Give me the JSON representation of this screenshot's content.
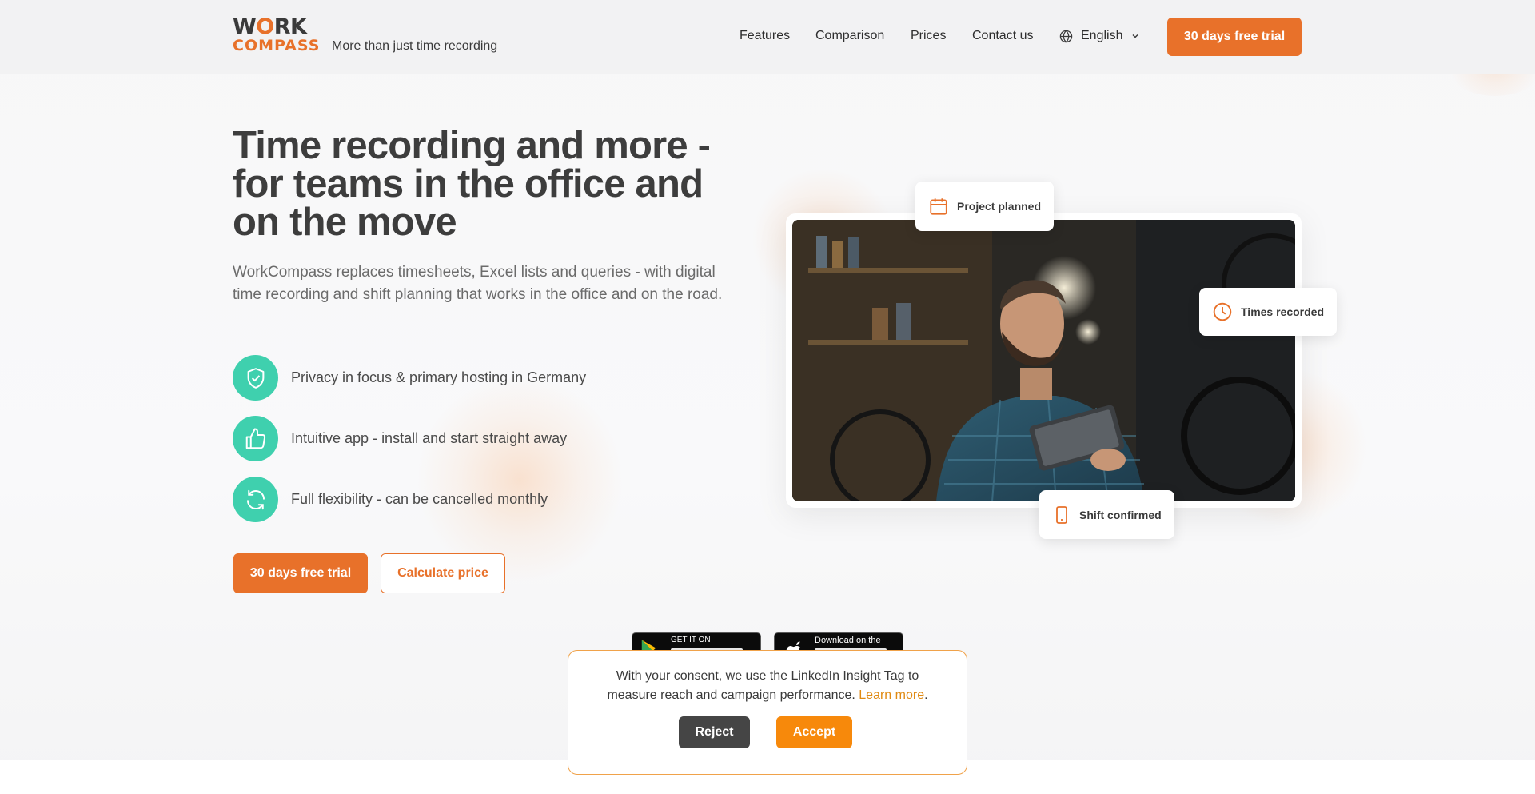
{
  "header": {
    "logo_line1_prefix": "W",
    "logo_line1_o": "O",
    "logo_line1_suffix": "RK",
    "logo_line2": "COMPASS",
    "tagline": "More than just time recording",
    "nav": [
      "Features",
      "Comparison",
      "Prices",
      "Contact us"
    ],
    "language": "English",
    "cta": "30 days free trial"
  },
  "hero": {
    "title": "Time recording and more - for teams in the office and on the move",
    "subtitle": "WorkCompass replaces timesheets, Excel lists and queries - with digital time recording and shift planning that works in the office and on the road.",
    "features": [
      {
        "icon": "shield-check-icon",
        "text": "Privacy in focus & primary hosting in Germany"
      },
      {
        "icon": "thumbs-up-icon",
        "text": "Intuitive app - install and start straight away"
      },
      {
        "icon": "refresh-icon",
        "text": "Full flexibility - can be cancelled monthly"
      }
    ],
    "primary_button": "30 days free trial",
    "secondary_button": "Calculate price"
  },
  "image_tags": {
    "project": "Project planned",
    "times": "Times recorded",
    "shift": "Shift confirmed"
  },
  "stores": {
    "google_top": "GET IT ON",
    "apple_top": "Download on the"
  },
  "consent": {
    "text": "With your consent, we use the LinkedIn Insight Tag to measure reach and campaign performance.",
    "link": "Learn more",
    "after_link": ".",
    "reject": "Reject",
    "accept": "Accept"
  },
  "colors": {
    "accent": "#e8712a",
    "teal": "#3fd0ae",
    "accept": "#f7890b",
    "reject": "#454545"
  }
}
